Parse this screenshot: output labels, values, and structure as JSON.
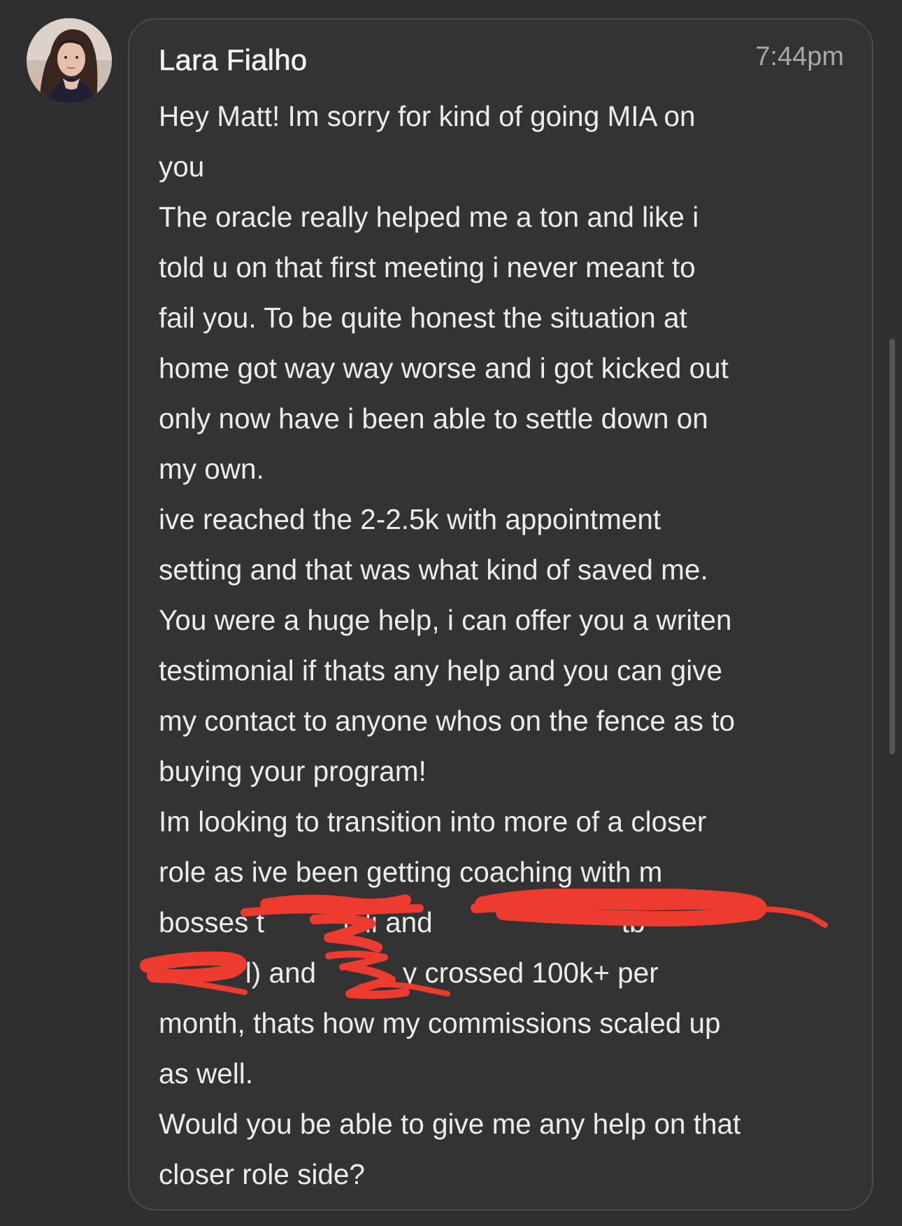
{
  "message": {
    "sender": "Lara Fialho",
    "time": "7:44pm",
    "lines": [
      "Hey Matt! Im sorry for kind of going MIA on",
      "you",
      "The oracle really helped me a ton and like i",
      "told u on that first meeting i never meant to",
      "fail you. To be quite honest the situation at",
      "home got way way worse and i got kicked out",
      "only now have i been able to settle down on",
      "my own.",
      "ive reached the 2-2.5k with appointment",
      "setting and that was what kind of saved me.",
      "You were a huge help, i can offer you a writen",
      "testimonial if thats any help and you can give",
      "my contact to anyone whos on the fence as to",
      "buying your program!",
      "Im looking to transition into more of a closer",
      "role as ive been getting coaching with m",
      "bosses t          hili and                        tb",
      "           l) and           y crossed 100k+ per",
      "month, thats how my commissions scaled up",
      "as well.",
      "Would you be able to give me any help on that",
      "closer role side?"
    ]
  },
  "colors": {
    "background": "#2f2f2f",
    "bubble": "#333333",
    "text": "#ececec",
    "timestamp": "#a8a8a8",
    "redaction": "#ee3b2f"
  },
  "icons": {
    "avatar": "profile-photo"
  }
}
